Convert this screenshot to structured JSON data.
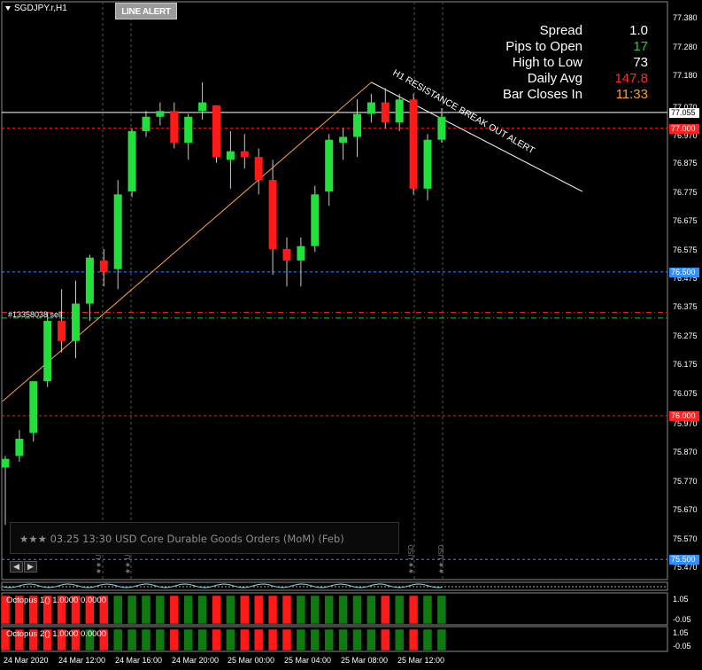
{
  "symbol_title": "SGDJPY.r,H1",
  "line_alert_button": "LINE ALERT",
  "info_panel": [
    {
      "label": "Spread",
      "value": "1.0",
      "color": "#ffffff"
    },
    {
      "label": "Pips to Open",
      "value": "17",
      "color": "#2ecc40"
    },
    {
      "label": "High to Low",
      "value": "73",
      "color": "#ffffff"
    },
    {
      "label": "Daily Avg",
      "value": "147.8",
      "color": "#ff2a2a"
    },
    {
      "label": "Bar Closes In",
      "value": "11:33",
      "color": "#ff9f1a"
    }
  ],
  "trendline_label": "H1 RESISTANCE BREAK OUT ALERT",
  "order_label": "#13358038 sell",
  "news_text": "★★★ 03.25 13:30 USD Core Durable Goods Orders (MoM) (Feb)",
  "news_markers": [
    "USD",
    "USD",
    "USD",
    "USD"
  ],
  "price_axis": [
    "77.380",
    "77.280",
    "77.180",
    "77.070",
    "76.970",
    "76.875",
    "76.775",
    "76.675",
    "76.575",
    "76.475",
    "76.375",
    "76.275",
    "76.175",
    "76.075",
    "75.970",
    "75.870",
    "75.770",
    "75.670",
    "75.570",
    "75.470"
  ],
  "price_tags": [
    {
      "value": "77.055",
      "bg": "#ffffff",
      "fg": "#000000"
    },
    {
      "value": "77.000",
      "bg": "#ff2020",
      "fg": "#ffffff"
    },
    {
      "value": "76.500",
      "bg": "#2f8fff",
      "fg": "#ffffff"
    },
    {
      "value": "76.000",
      "bg": "#ff2020",
      "fg": "#ffffff"
    },
    {
      "value": "75.500",
      "bg": "#2f8fff",
      "fg": "#ffffff"
    }
  ],
  "time_axis": [
    "24 Mar 2020",
    "24 Mar 12:00",
    "24 Mar 16:00",
    "24 Mar 20:00",
    "25 Mar 00:00",
    "25 Mar 04:00",
    "25 Mar 08:00",
    "25 Mar 12:00"
  ],
  "indicators": [
    {
      "label": "Octopus 1() 1.0000 0.0000",
      "axis_top": "1.05",
      "axis_bottom": "-0.05"
    },
    {
      "label": "Octopus 2() 1.0000 0.0000",
      "axis_top": "1.05",
      "axis_bottom": "-0.05"
    }
  ],
  "colors": {
    "bull": "#22e03a",
    "bear": "#ff1a1a",
    "wick": "#c8c8c8",
    "grid": "#555555",
    "trend_orange": "#ffa040"
  },
  "chart_data": {
    "type": "candlestick",
    "candles": [
      {
        "o": 75.82,
        "h": 75.86,
        "l": 75.62,
        "c": 75.85
      },
      {
        "o": 75.86,
        "h": 75.95,
        "l": 75.84,
        "c": 75.92
      },
      {
        "o": 75.94,
        "h": 76.12,
        "l": 75.91,
        "c": 76.12
      },
      {
        "o": 76.12,
        "h": 76.36,
        "l": 76.1,
        "c": 76.33
      },
      {
        "o": 76.33,
        "h": 76.44,
        "l": 76.22,
        "c": 76.26
      },
      {
        "o": 76.26,
        "h": 76.47,
        "l": 76.2,
        "c": 76.39
      },
      {
        "o": 76.39,
        "h": 76.56,
        "l": 76.33,
        "c": 76.55
      },
      {
        "o": 76.54,
        "h": 76.58,
        "l": 76.45,
        "c": 76.5
      },
      {
        "o": 76.51,
        "h": 76.82,
        "l": 76.44,
        "c": 76.77
      },
      {
        "o": 76.78,
        "h": 77.0,
        "l": 76.76,
        "c": 76.99
      },
      {
        "o": 76.99,
        "h": 77.06,
        "l": 76.97,
        "c": 77.04
      },
      {
        "o": 77.04,
        "h": 77.09,
        "l": 77.01,
        "c": 77.06
      },
      {
        "o": 77.06,
        "h": 77.09,
        "l": 76.93,
        "c": 76.95
      },
      {
        "o": 76.95,
        "h": 77.05,
        "l": 76.89,
        "c": 77.04
      },
      {
        "o": 77.06,
        "h": 77.16,
        "l": 77.03,
        "c": 77.09
      },
      {
        "o": 77.08,
        "h": 77.08,
        "l": 76.88,
        "c": 76.9
      },
      {
        "o": 76.89,
        "h": 76.99,
        "l": 76.79,
        "c": 76.92
      },
      {
        "o": 76.92,
        "h": 76.98,
        "l": 76.86,
        "c": 76.9
      },
      {
        "o": 76.9,
        "h": 76.93,
        "l": 76.77,
        "c": 76.82
      },
      {
        "o": 76.82,
        "h": 76.89,
        "l": 76.49,
        "c": 76.58
      },
      {
        "o": 76.58,
        "h": 76.62,
        "l": 76.45,
        "c": 76.54
      },
      {
        "o": 76.54,
        "h": 76.62,
        "l": 76.45,
        "c": 76.59
      },
      {
        "o": 76.59,
        "h": 76.8,
        "l": 76.57,
        "c": 76.77
      },
      {
        "o": 76.78,
        "h": 76.98,
        "l": 76.73,
        "c": 76.96
      },
      {
        "o": 76.95,
        "h": 77.0,
        "l": 76.89,
        "c": 76.97
      },
      {
        "o": 76.97,
        "h": 77.1,
        "l": 76.9,
        "c": 77.05
      },
      {
        "o": 77.05,
        "h": 77.12,
        "l": 77.02,
        "c": 77.09
      },
      {
        "o": 77.09,
        "h": 77.14,
        "l": 77.0,
        "c": 77.02
      },
      {
        "o": 77.02,
        "h": 77.12,
        "l": 76.99,
        "c": 77.1
      },
      {
        "o": 77.1,
        "h": 77.12,
        "l": 76.77,
        "c": 76.79
      },
      {
        "o": 76.79,
        "h": 76.98,
        "l": 76.75,
        "c": 76.96
      },
      {
        "o": 76.96,
        "h": 77.07,
        "l": 76.95,
        "c": 77.04
      }
    ],
    "ylim": [
      75.43,
      77.44
    ],
    "horizontal_levels": [
      77.055,
      77.0,
      76.5,
      76.36,
      76.34,
      76.0,
      75.5
    ],
    "resistance_trendline": [
      {
        "bar": 26.0,
        "price": 77.16
      },
      {
        "bar": 41.0,
        "price": 76.78
      }
    ],
    "support_trendline": [
      {
        "bar": -0.2,
        "price": 76.05
      },
      {
        "bar": 26.0,
        "price": 77.16
      }
    ],
    "octopus_1": [
      "red",
      "red",
      "red",
      "red",
      "red",
      "red",
      "red",
      "red",
      "green",
      "green",
      "green",
      "green",
      "red",
      "green",
      "green",
      "red",
      "green",
      "red",
      "red",
      "red",
      "red",
      "green",
      "green",
      "green",
      "green",
      "green",
      "green",
      "red",
      "green",
      "red",
      "green",
      "green"
    ],
    "octopus_2": [
      "red",
      "red",
      "red",
      "red",
      "red",
      "red",
      "green",
      "red",
      "green",
      "green",
      "green",
      "green",
      "red",
      "green",
      "green",
      "red",
      "green",
      "red",
      "red",
      "red",
      "red",
      "green",
      "green",
      "green",
      "green",
      "green",
      "green",
      "red",
      "green",
      "red",
      "green",
      "green"
    ]
  }
}
